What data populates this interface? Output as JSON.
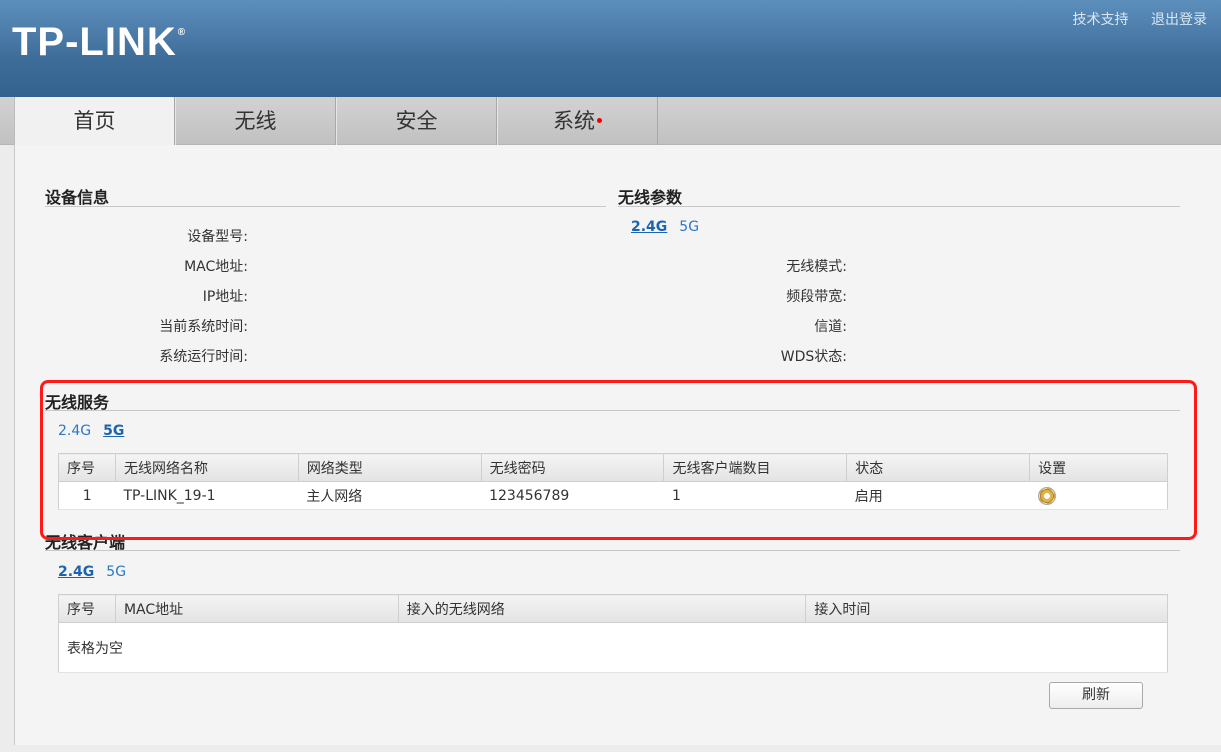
{
  "brand": {
    "logo": "TP-LINK",
    "reg": "®"
  },
  "top_links": [
    "技术支持",
    "退出登录"
  ],
  "nav": {
    "tabs": [
      "首页",
      "无线",
      "安全",
      "系统"
    ],
    "active_index": 0
  },
  "device_info": {
    "title": "设备信息",
    "fields": [
      "设备型号:",
      "MAC地址:",
      "IP地址:",
      "当前系统时间:",
      "系统运行时间:"
    ]
  },
  "wireless_params": {
    "title": "无线参数",
    "bands": [
      "2.4G",
      "5G"
    ],
    "selected_band": "2.4G",
    "fields": [
      "无线模式:",
      "频段带宽:",
      "信道:",
      "WDS状态:"
    ]
  },
  "wireless_service": {
    "title": "无线服务",
    "bands": [
      "2.4G",
      "5G"
    ],
    "selected_band": "5G",
    "columns": [
      "序号",
      "无线网络名称",
      "网络类型",
      "无线密码",
      "无线客户端数目",
      "状态",
      "设置"
    ],
    "rows": [
      {
        "index": "1",
        "ssid": "TP-LINK_19-1",
        "type": "主人网络",
        "password": "123456789",
        "clients": "1",
        "status": "启用",
        "settings_icon": "gear-icon"
      }
    ]
  },
  "wireless_clients": {
    "title": "无线客户端",
    "bands": [
      "2.4G",
      "5G"
    ],
    "selected_band": "2.4G",
    "columns": [
      "序号",
      "MAC地址",
      "接入的无线网络",
      "接入时间"
    ],
    "empty_text": "表格为空"
  },
  "refresh_label": "刷新",
  "colors": {
    "header": "#3f6d9a",
    "link": "#2a78c6",
    "highlight": "#ff1a1a",
    "alert_dot": "#ee0000"
  }
}
